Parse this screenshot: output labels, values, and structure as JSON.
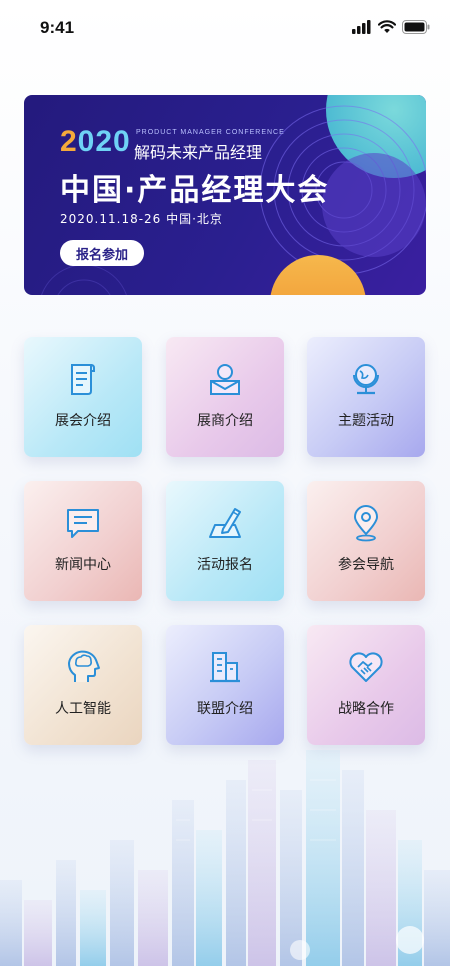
{
  "status_bar": {
    "time": "9:41",
    "icons": [
      "signal-icon",
      "wifi-icon",
      "battery-icon"
    ]
  },
  "banner": {
    "year": "2020",
    "conference_en": "PRODUCT MANAGER CONFERENCE",
    "subtitle": "解码未来产品经理",
    "title": "中国·产品经理大会",
    "date_location": "2020.11.18-26 中国·北京",
    "register_label": "报名参加",
    "colors": {
      "background": "#241a7d",
      "accent_orange": "#f4a93b",
      "accent_cyan": "#6fd2f5"
    }
  },
  "grid": [
    {
      "label": "展会介绍",
      "icon": "scroll-icon"
    },
    {
      "label": "展商介绍",
      "icon": "user-card-icon"
    },
    {
      "label": "主题活动",
      "icon": "globe-icon"
    },
    {
      "label": "新闻中心",
      "icon": "message-icon"
    },
    {
      "label": "活动报名",
      "icon": "edit-icon"
    },
    {
      "label": "参会导航",
      "icon": "location-pin-icon"
    },
    {
      "label": "人工智能",
      "icon": "brain-head-icon"
    },
    {
      "label": "联盟介绍",
      "icon": "building-icon"
    },
    {
      "label": "战略合作",
      "icon": "handshake-icon"
    }
  ],
  "colors": {
    "icon_stroke": "#2b8fd8",
    "label": "#222222"
  }
}
